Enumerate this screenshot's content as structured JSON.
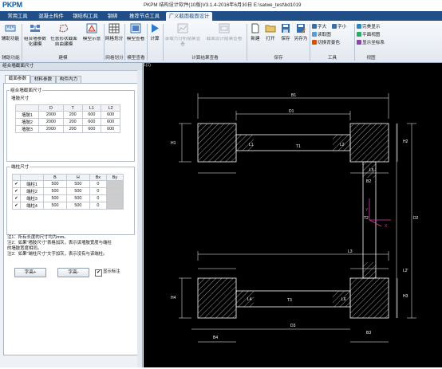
{
  "titlebar": {
    "logo_a": "PK",
    "logo_b": "PM",
    "title": "PKPM 结构设计软件(10版)V3.1.4-2016年6月30日 E:\\satwe_test\\bd1019"
  },
  "menu": {
    "tabs": [
      "常用工具",
      "混凝土构件",
      "钢结构工具",
      "钢绑",
      "推荐节点工具",
      "广义截面截面设计"
    ],
    "active": 5
  },
  "ribbon": {
    "buttons": [
      "辅助功能",
      "组合墙参数化建模",
      "任意形状截面自由建模",
      "模型示意",
      "网格划分",
      "模型查看",
      "计算",
      "承载力分析结果查看",
      "截面设计结果查看",
      "新建",
      "打开",
      "保存",
      "另存为"
    ],
    "small": [
      "字大",
      "字小",
      "读取图",
      "切换背景色",
      "完美显示",
      "平面视图",
      "显示坐标系"
    ],
    "groups": [
      "辅助功能",
      "建模",
      "网格划分",
      "模型查看",
      "计算结果查看",
      "保存",
      "工具",
      "视图"
    ]
  },
  "panel": {
    "header": "组合墙截面尺寸",
    "tabs": [
      "截面参数",
      "材料参数",
      "构件内力"
    ],
    "wall_group": "组合墙截面尺寸",
    "wall_sub": "墙肢尺寸",
    "wall_headers": [
      "",
      "D",
      "T",
      "L1",
      "L2"
    ],
    "wall_rows": [
      [
        "墙肢1",
        "2000",
        "200",
        "600",
        "600"
      ],
      [
        "墙肢2",
        "2000",
        "200",
        "600",
        "600"
      ],
      [
        "墙肢3",
        "2000",
        "200",
        "600",
        "600"
      ]
    ],
    "col_group": "端柱尺寸",
    "col_headers": [
      "",
      "",
      "B",
      "H",
      "Bx",
      "By"
    ],
    "col_rows": [
      [
        "✔",
        "端柱1",
        "500",
        "500",
        "0",
        ""
      ],
      [
        "✔",
        "端柱2",
        "500",
        "500",
        "0",
        ""
      ],
      [
        "✔",
        "端柱3",
        "500",
        "500",
        "0",
        ""
      ],
      [
        "✔",
        "端柱4",
        "500",
        "500",
        "0",
        ""
      ]
    ],
    "notes": [
      "注1：所有长度的尺寸均为mm。",
      "注2：如果\"墙肢尺寸\"表格加灰，表示该墙肢宽度与端柱",
      "      的墙肢宽度相同。",
      "注3：如果\"端柱尺寸\"文字加灰，表示没有与该端柱。"
    ],
    "btn_bigger": "字高+",
    "btn_smaller": "字高-",
    "show_label": "显示标注",
    "show_checked": "✔"
  },
  "canvas": {
    "tab": "1(1)",
    "dims": [
      "B1",
      "H1",
      "T1",
      "L1",
      "L2",
      "D1",
      "T2",
      "L3",
      "L5",
      "B2",
      "H2",
      "D2",
      "B3",
      "H3",
      "T3",
      "L6",
      "L4",
      "D3",
      "B4",
      "H4",
      "L2'"
    ]
  }
}
